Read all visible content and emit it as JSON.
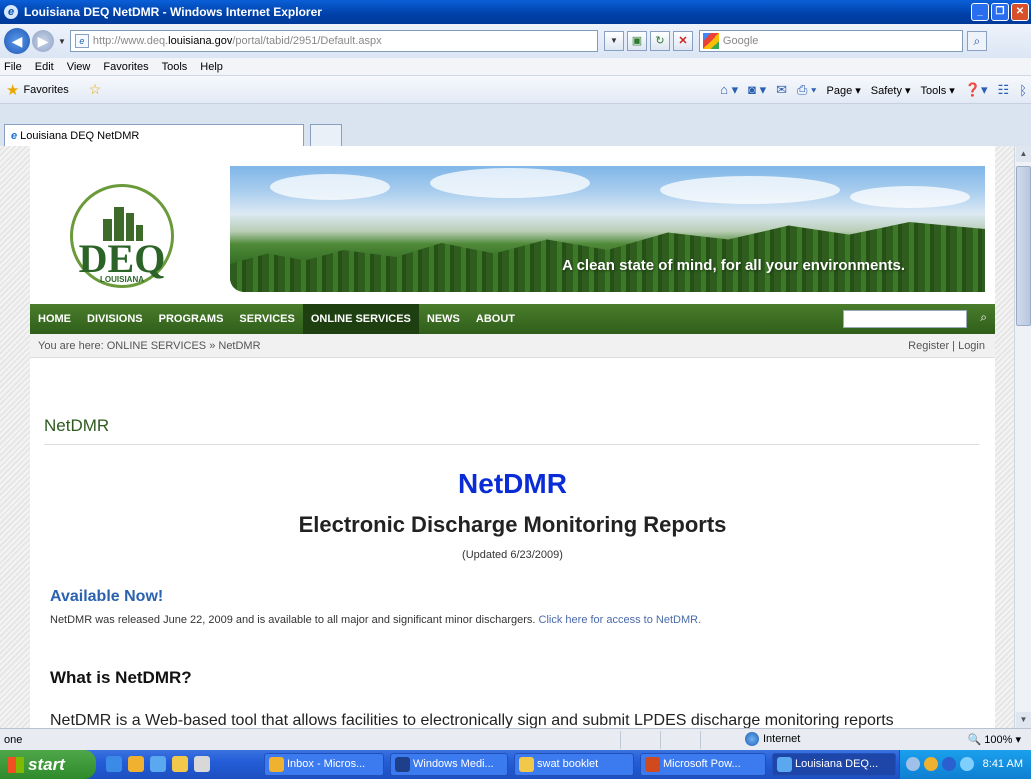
{
  "window": {
    "title": "Louisiana DEQ NetDMR - Windows Internet Explorer"
  },
  "address": {
    "url_prefix": "http://www.deq.",
    "url_domain": "louisiana.gov",
    "url_path": "/portal/tabid/2951/Default.aspx",
    "search_placeholder": "Google"
  },
  "menu": [
    "File",
    "Edit",
    "View",
    "Favorites",
    "Tools",
    "Help"
  ],
  "favorites": {
    "label": "Favorites"
  },
  "command_bar": {
    "page": "Page",
    "safety": "Safety",
    "tools": "Tools"
  },
  "tab": {
    "label": "Louisiana DEQ NetDMR"
  },
  "site": {
    "logo_text": "DEQ",
    "logo_sub": "LOUISIANA",
    "tagline": "A clean state of mind, for all your environments.",
    "nav": [
      "HOME",
      "DIVISIONS",
      "PROGRAMS",
      "SERVICES",
      "ONLINE SERVICES",
      "NEWS",
      "ABOUT"
    ],
    "active_nav": "ONLINE SERVICES",
    "breadcrumb": "You are here: ONLINE SERVICES » NetDMR",
    "register_login": "Register | Login",
    "page_title": "NetDMR"
  },
  "content": {
    "heading": "NetDMR",
    "subheading": "Electronic Discharge Monitoring Reports",
    "updated": "(Updated 6/23/2009)",
    "available_heading": "Available Now!",
    "available_text": "NetDMR was released June 22, 2009 and is available to all major and significant minor dischargers. ",
    "available_link": "Click here for access to NetDMR.",
    "what_heading": "What is NetDMR?",
    "body_partial": "NetDMR is a Web-based tool that allows facilities to electronically sign and submit LPDES discharge monitoring reports"
  },
  "status": {
    "text": "one",
    "zone": "Internet",
    "zoom": "100%"
  },
  "taskbar": {
    "start": "start",
    "buttons": [
      "Inbox - Micros...",
      "Windows Medi...",
      "swat booklet",
      "Microsoft Pow...",
      "Louisiana DEQ..."
    ],
    "clock": "8:41 AM"
  },
  "colors": {
    "nav_green": "#2f5e1a",
    "heading_blue": "#0a2cd6",
    "link_blue": "#4a6aa8",
    "title_green": "#2e5a1e"
  }
}
